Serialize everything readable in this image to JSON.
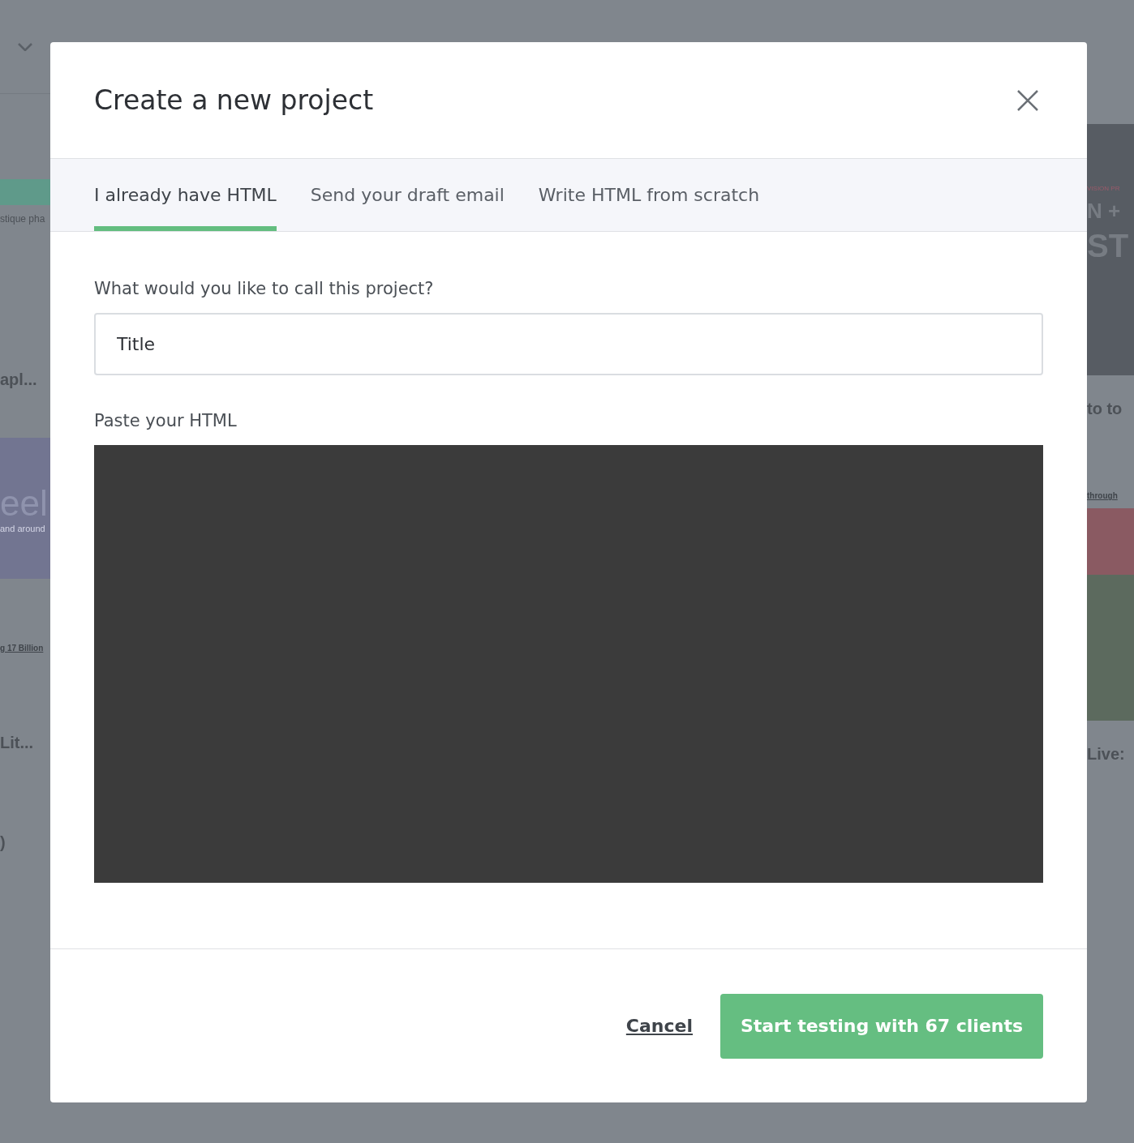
{
  "background": {
    "left": [
      {
        "kind": "caption",
        "text": "stique pha"
      },
      {
        "kind": "heading",
        "text": "apl..."
      },
      {
        "kind": "hero",
        "text": "eel",
        "sub": "and around"
      },
      {
        "kind": "link",
        "text": "g 17 Billion"
      },
      {
        "kind": "heading",
        "text": "Lit..."
      },
      {
        "kind": "heading",
        "text": ")"
      }
    ],
    "right": [
      {
        "kind": "poster",
        "text": "N +",
        "sub": "ST",
        "tag": "VISION PR"
      },
      {
        "kind": "heading",
        "text": "to to"
      },
      {
        "kind": "link",
        "text": "through"
      },
      {
        "kind": "heading",
        "text": "Live:"
      }
    ]
  },
  "dialog": {
    "title": "Create a new project",
    "tabs": [
      {
        "label": "I already have HTML",
        "selected": true
      },
      {
        "label": "Send your draft email",
        "selected": false
      },
      {
        "label": "Write HTML from scratch",
        "selected": false
      }
    ],
    "name_field": {
      "label": "What would you like to call this project?",
      "value": "Title"
    },
    "html_field": {
      "label": "Paste your HTML"
    },
    "cancel": "Cancel",
    "submit": "Start testing with 67 clients"
  }
}
